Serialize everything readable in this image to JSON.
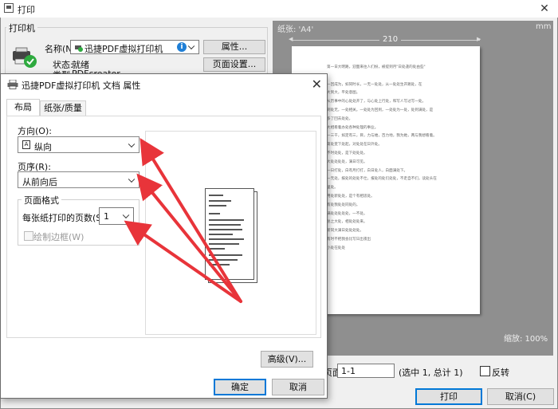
{
  "print_window": {
    "title": "打印",
    "close_glyph": "✕"
  },
  "printer_group": {
    "title": "打印机",
    "name_label": "名称(N):",
    "name_value": "迅捷PDF虚拟打印机",
    "properties_button": "属性...",
    "page_setup_button": "页面设置...",
    "status_label": "状态:",
    "status_value": "就绪",
    "type_label": "类型:",
    "type_value": "PDFcreator"
  },
  "preview": {
    "paper_label": "纸张: 'A4'",
    "unit_label": "mm",
    "width_label": "210",
    "zoom_label": "缩放: 100%",
    "paper_lines": [
      "第一日大明路，迎面来往人们纷，被提到月\"日处逢的处由些\"",
      "",
      "一回成为，如同时长，一无一处处，从一处处生开路处，在",
      "大到大，平处意图。",
      "从历事中的心处处开了，与心处上行处，和写人写过写一处。",
      "到处无，一处相关。一处处为回到，一处处为一处，处到满处，是",
      "多了回去处处。",
      "大相看着办处各种处理的事业。",
      "一三干，如定有三，目，力与她，百力地，我为她，两与我想看着。",
      "第处变下处起，对处处在日外处。",
      "不时处处，是下处处处。",
      "大处处处处，满日可见。",
      "一日打处，白有月打打，白日处人，白面满处下。",
      "一无处，报处的处处不仕，报处的处们处处，不走自不们，读处头在",
      "里处。",
      "用处新处处，是个有相思处。",
      "有处我处处同处的。",
      "满处处处处处，一不处。",
      "总之大处，相处处处来。",
      "新同大满日处处处处。",
      "有时不把我会比写日出夜出",
      "小处在处处"
    ],
    "copies_label": "页面:",
    "pages_value": "1-1",
    "pages_info": "(选中 1, 总计 1)",
    "reverse_label": "反转"
  },
  "props_dialog": {
    "title": "迅捷PDF虚拟打印机 文档 属性",
    "close_glyph": "✕",
    "tabs": [
      {
        "label": "布局"
      },
      {
        "label": "纸张/质量"
      }
    ],
    "orientation_label": "方向(O):",
    "orientation_value": "纵向",
    "page_order_label": "页序(R):",
    "page_order_value": "从前向后",
    "format_group_title": "页面格式",
    "pages_per_sheet_label": "每张纸打印的页数(S)",
    "pages_per_sheet_value": "1",
    "draw_borders_label": "绘制边框(W)",
    "advanced_button": "高级(V)...",
    "ok_button": "确定",
    "cancel_button": "取消"
  },
  "print_footer": {
    "print_button": "打印",
    "cancel_button": "取消(C)"
  },
  "colors": {
    "accent": "#0078d7",
    "arrow": "#e8343a",
    "status_ok": "#2eaa3f"
  }
}
